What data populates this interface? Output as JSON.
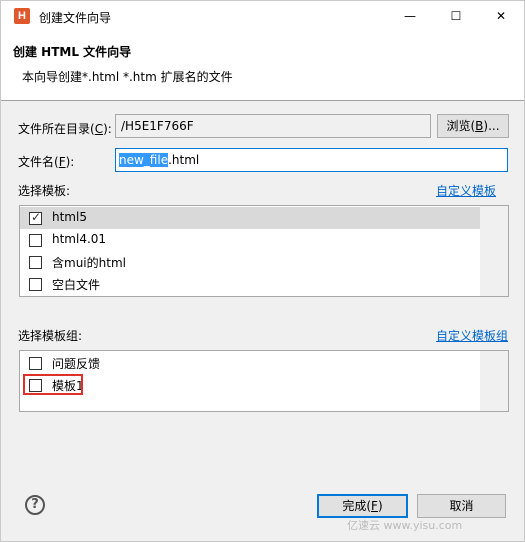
{
  "window": {
    "title": "创建文件向导",
    "app_icon_letter": "H",
    "controls": {
      "minimize": "—",
      "maximize": "☐",
      "close": "✕"
    }
  },
  "banner": {
    "title": "创建 HTML 文件向导",
    "description": "本向导创建*.html *.htm 扩展名的文件"
  },
  "directory": {
    "label": "文件所在目录(",
    "label_hotkey": "C",
    "label_suffix": "):",
    "value": "/H5E1F766F",
    "browse_label": "浏览(",
    "browse_hotkey": "B",
    "browse_suffix": ")..."
  },
  "filename": {
    "label": "文件名(",
    "label_hotkey": "F",
    "label_suffix": "):",
    "value_selected": "new_file",
    "value_rest": ".html"
  },
  "templates": {
    "label": "选择模板:",
    "custom_link": "自定义模板",
    "items": [
      {
        "label": "html5",
        "checked": true
      },
      {
        "label": "html4.01",
        "checked": false
      },
      {
        "label": "含mui的html",
        "checked": false
      },
      {
        "label": "空白文件",
        "checked": false
      }
    ]
  },
  "template_groups": {
    "label": "选择模板组:",
    "custom_link": "自定义模板组",
    "items": [
      {
        "label": "问题反馈",
        "checked": false
      },
      {
        "label": "模板1",
        "checked": false
      }
    ]
  },
  "footer": {
    "help_symbol": "?",
    "finish_label": "完成(",
    "finish_hotkey": "F",
    "finish_suffix": ")",
    "cancel_label": "取消"
  },
  "watermark": "亿速云 www.yisu.com",
  "colors": {
    "accent": "#0078d7",
    "link": "#0066cc",
    "highlight_box": "#e0302a",
    "app_icon": "#e0572c"
  }
}
